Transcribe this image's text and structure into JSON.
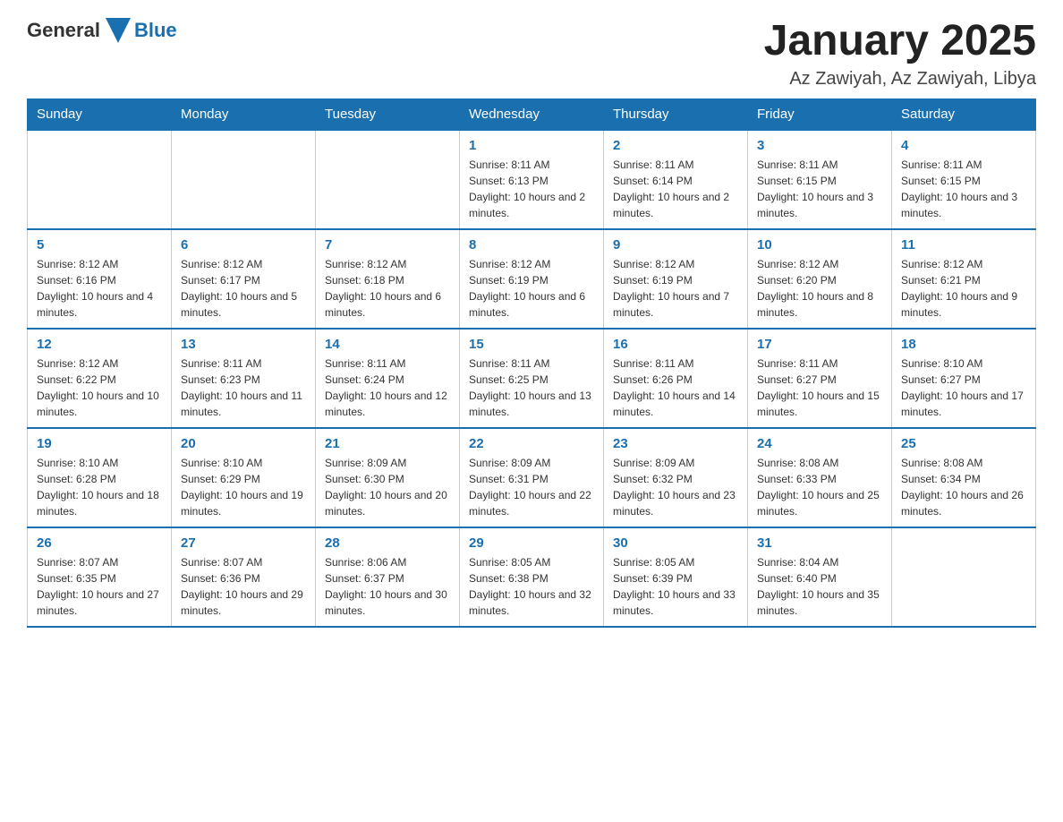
{
  "header": {
    "logo": {
      "general": "General",
      "blue": "Blue"
    },
    "title": "January 2025",
    "location": "Az Zawiyah, Az Zawiyah, Libya"
  },
  "days_of_week": [
    "Sunday",
    "Monday",
    "Tuesday",
    "Wednesday",
    "Thursday",
    "Friday",
    "Saturday"
  ],
  "weeks": [
    [
      {
        "day": "",
        "info": ""
      },
      {
        "day": "",
        "info": ""
      },
      {
        "day": "",
        "info": ""
      },
      {
        "day": "1",
        "info": "Sunrise: 8:11 AM\nSunset: 6:13 PM\nDaylight: 10 hours and 2 minutes."
      },
      {
        "day": "2",
        "info": "Sunrise: 8:11 AM\nSunset: 6:14 PM\nDaylight: 10 hours and 2 minutes."
      },
      {
        "day": "3",
        "info": "Sunrise: 8:11 AM\nSunset: 6:15 PM\nDaylight: 10 hours and 3 minutes."
      },
      {
        "day": "4",
        "info": "Sunrise: 8:11 AM\nSunset: 6:15 PM\nDaylight: 10 hours and 3 minutes."
      }
    ],
    [
      {
        "day": "5",
        "info": "Sunrise: 8:12 AM\nSunset: 6:16 PM\nDaylight: 10 hours and 4 minutes."
      },
      {
        "day": "6",
        "info": "Sunrise: 8:12 AM\nSunset: 6:17 PM\nDaylight: 10 hours and 5 minutes."
      },
      {
        "day": "7",
        "info": "Sunrise: 8:12 AM\nSunset: 6:18 PM\nDaylight: 10 hours and 6 minutes."
      },
      {
        "day": "8",
        "info": "Sunrise: 8:12 AM\nSunset: 6:19 PM\nDaylight: 10 hours and 6 minutes."
      },
      {
        "day": "9",
        "info": "Sunrise: 8:12 AM\nSunset: 6:19 PM\nDaylight: 10 hours and 7 minutes."
      },
      {
        "day": "10",
        "info": "Sunrise: 8:12 AM\nSunset: 6:20 PM\nDaylight: 10 hours and 8 minutes."
      },
      {
        "day": "11",
        "info": "Sunrise: 8:12 AM\nSunset: 6:21 PM\nDaylight: 10 hours and 9 minutes."
      }
    ],
    [
      {
        "day": "12",
        "info": "Sunrise: 8:12 AM\nSunset: 6:22 PM\nDaylight: 10 hours and 10 minutes."
      },
      {
        "day": "13",
        "info": "Sunrise: 8:11 AM\nSunset: 6:23 PM\nDaylight: 10 hours and 11 minutes."
      },
      {
        "day": "14",
        "info": "Sunrise: 8:11 AM\nSunset: 6:24 PM\nDaylight: 10 hours and 12 minutes."
      },
      {
        "day": "15",
        "info": "Sunrise: 8:11 AM\nSunset: 6:25 PM\nDaylight: 10 hours and 13 minutes."
      },
      {
        "day": "16",
        "info": "Sunrise: 8:11 AM\nSunset: 6:26 PM\nDaylight: 10 hours and 14 minutes."
      },
      {
        "day": "17",
        "info": "Sunrise: 8:11 AM\nSunset: 6:27 PM\nDaylight: 10 hours and 15 minutes."
      },
      {
        "day": "18",
        "info": "Sunrise: 8:10 AM\nSunset: 6:27 PM\nDaylight: 10 hours and 17 minutes."
      }
    ],
    [
      {
        "day": "19",
        "info": "Sunrise: 8:10 AM\nSunset: 6:28 PM\nDaylight: 10 hours and 18 minutes."
      },
      {
        "day": "20",
        "info": "Sunrise: 8:10 AM\nSunset: 6:29 PM\nDaylight: 10 hours and 19 minutes."
      },
      {
        "day": "21",
        "info": "Sunrise: 8:09 AM\nSunset: 6:30 PM\nDaylight: 10 hours and 20 minutes."
      },
      {
        "day": "22",
        "info": "Sunrise: 8:09 AM\nSunset: 6:31 PM\nDaylight: 10 hours and 22 minutes."
      },
      {
        "day": "23",
        "info": "Sunrise: 8:09 AM\nSunset: 6:32 PM\nDaylight: 10 hours and 23 minutes."
      },
      {
        "day": "24",
        "info": "Sunrise: 8:08 AM\nSunset: 6:33 PM\nDaylight: 10 hours and 25 minutes."
      },
      {
        "day": "25",
        "info": "Sunrise: 8:08 AM\nSunset: 6:34 PM\nDaylight: 10 hours and 26 minutes."
      }
    ],
    [
      {
        "day": "26",
        "info": "Sunrise: 8:07 AM\nSunset: 6:35 PM\nDaylight: 10 hours and 27 minutes."
      },
      {
        "day": "27",
        "info": "Sunrise: 8:07 AM\nSunset: 6:36 PM\nDaylight: 10 hours and 29 minutes."
      },
      {
        "day": "28",
        "info": "Sunrise: 8:06 AM\nSunset: 6:37 PM\nDaylight: 10 hours and 30 minutes."
      },
      {
        "day": "29",
        "info": "Sunrise: 8:05 AM\nSunset: 6:38 PM\nDaylight: 10 hours and 32 minutes."
      },
      {
        "day": "30",
        "info": "Sunrise: 8:05 AM\nSunset: 6:39 PM\nDaylight: 10 hours and 33 minutes."
      },
      {
        "day": "31",
        "info": "Sunrise: 8:04 AM\nSunset: 6:40 PM\nDaylight: 10 hours and 35 minutes."
      },
      {
        "day": "",
        "info": ""
      }
    ]
  ]
}
